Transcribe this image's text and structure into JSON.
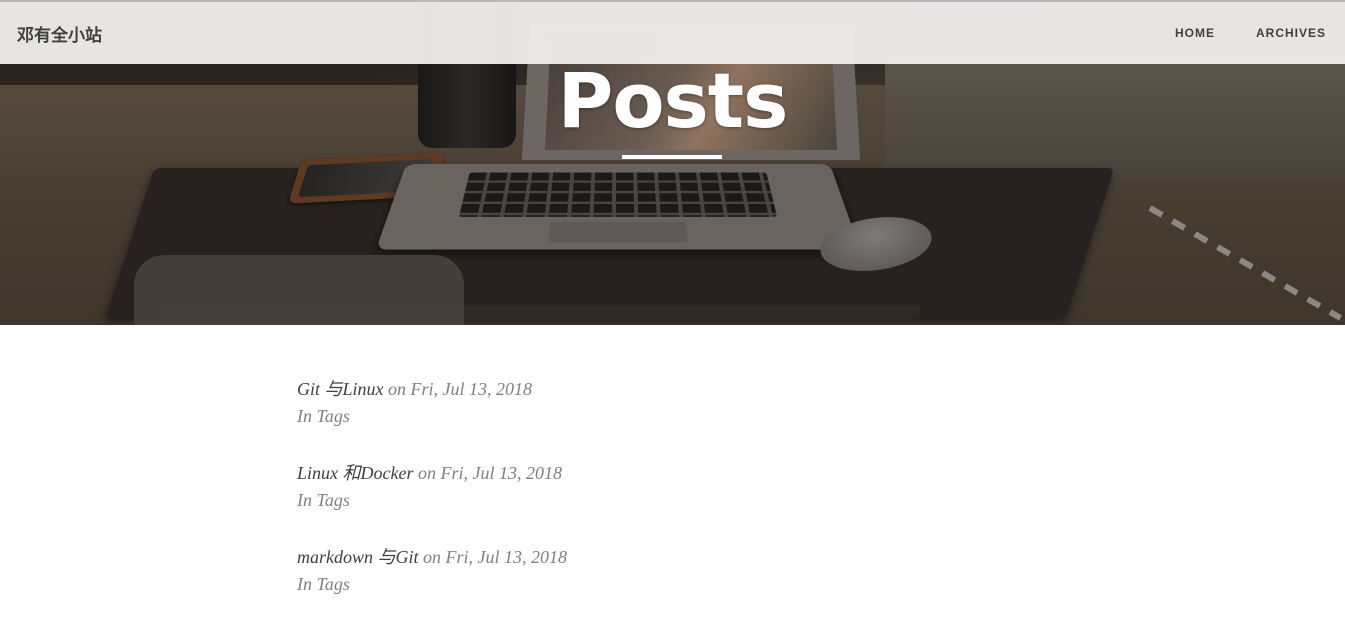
{
  "site": {
    "brand": "邓有全小站"
  },
  "nav": {
    "items": [
      {
        "label": "HOME"
      },
      {
        "label": "ARCHIVES"
      }
    ]
  },
  "hero": {
    "title": "Posts"
  },
  "posts": [
    {
      "title": "Git 与Linux",
      "date_text": "on Fri, Jul 13, 2018",
      "tags_text": "In Tags"
    },
    {
      "title": "Linux 和Docker",
      "date_text": "on Fri, Jul 13, 2018",
      "tags_text": "In Tags"
    },
    {
      "title": "markdown 与Git",
      "date_text": "on Fri, Jul 13, 2018",
      "tags_text": "In Tags"
    }
  ],
  "colors": {
    "navbar_bg": "#ecebe9",
    "text_dark": "#404040",
    "text_muted": "#808080",
    "hero_title": "#ffffff"
  }
}
